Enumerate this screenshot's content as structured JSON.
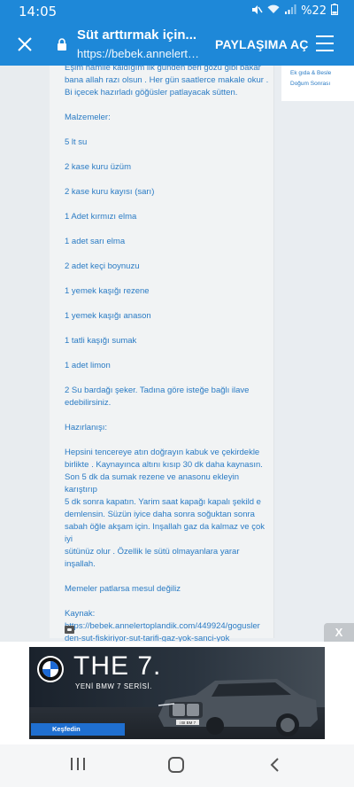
{
  "status_bar": {
    "time": "14:05",
    "battery": "%22",
    "icons": [
      "mute-icon",
      "wifi-icon",
      "signal-icon",
      "battery-icon"
    ]
  },
  "app_bar": {
    "title": "Süt arttırmak için...",
    "url": "https://bebek.annelertop...",
    "share_label": "PAYLAŞIMA AÇ",
    "background": "#1e88d8",
    "icons": [
      "close-icon",
      "lock-icon",
      "menu-icon"
    ]
  },
  "article": {
    "intro_line_1": "Eşim hamile kaldığım ilk günden beri gözü gibi bakar",
    "intro_line_2": "bana allah razı olsun . Her gün saatlerce makale okur .",
    "intro_line_3": "Bi içecek hazırladı göğüsler patlayacak sütten.",
    "ingredients_heading": "Malzemeler:",
    "ingredients": [
      "5 lt su",
      "2  kase kuru üzüm",
      "2  kase kuru kayısı (sarı)",
      "1 Adet kırmızı elma",
      "1 adet sarı elma",
      "2 adet keçi boynuzu",
      "1 yemek kaşığı rezene",
      "1 yemek kaşığı anason",
      "1 tatli kaşığı sumak",
      "1 adet limon"
    ],
    "sugar_line_1": "2 Su bardağı şeker.  Tadına göre isteğe bağlı ilave",
    "sugar_line_2": "edebilirsiniz.",
    "prep_heading": "Hazırlanışı:",
    "prep_lines": [
      "Hepsini tencereye atın doğrayın kabuk ve çekirdekle",
      "birlikte . Kaynayınca altını kısıp 30 dk daha kaynasın.",
      "Son 5 dk da sumak rezene ve anasonu ekleyin karıştırıp",
      "5 dk sonra kapatın.  Yarim saat kapağı kapalı şekild e",
      "demlensin.  Süzün iyice daha sonra soğuktan sonra",
      "sabah öğle akşam için.  Inşallah gaz da kalmaz ve çok iyi",
      "sütünüz olur . Özellik le sütü olmayanlara yarar",
      "inşallah."
    ],
    "disclaimer": "Memeler patlarsa mesul değiliz",
    "source_heading": "Kaynak:",
    "source_line_1": "https://bebek.annelertoplandik.com/449924/gogusler",
    "source_line_2": "den-sut-fiskiriyor-sut-tarifi-gaz-yok-sanci-yok",
    "text_color": "#2a7bc4"
  },
  "sidebar": {
    "links": [
      "Ek gıda & Besle",
      "Doğum Sonrası"
    ]
  },
  "ad": {
    "close_label": "X",
    "headline": "THE 7.",
    "subline": "YENİ BMW 7 SERİSİ.",
    "cta": "Keşfedin",
    "plate": "i BI BM 7",
    "cta_color": "#1f6fd0"
  },
  "nav_bar": {
    "icons": [
      "recent-apps-icon",
      "home-icon",
      "back-icon"
    ]
  }
}
